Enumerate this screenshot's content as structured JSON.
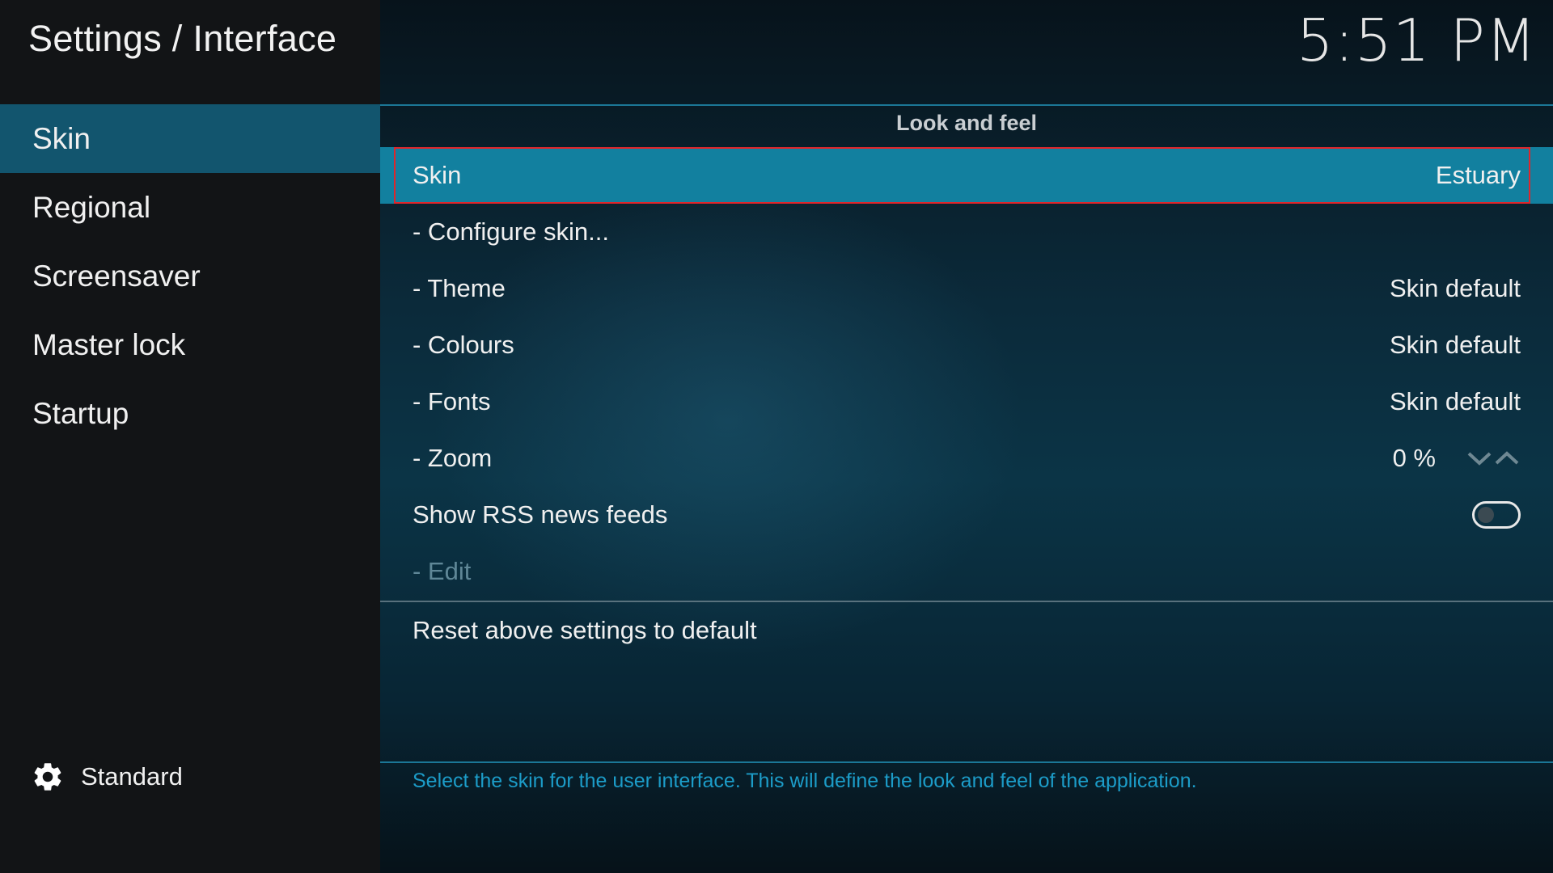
{
  "header": {
    "title": "Settings / Interface",
    "clock": "5:51 PM"
  },
  "sidebar": {
    "items": [
      {
        "label": "Skin",
        "active": true
      },
      {
        "label": "Regional",
        "active": false
      },
      {
        "label": "Screensaver",
        "active": false
      },
      {
        "label": "Master lock",
        "active": false
      },
      {
        "label": "Startup",
        "active": false
      }
    ],
    "settings_level": {
      "icon": "gear-icon",
      "label": "Standard"
    }
  },
  "main": {
    "group_title": "Look and feel",
    "settings": [
      {
        "label": "Skin",
        "value": "Estuary"
      },
      {
        "label": "- Configure skin...",
        "value": ""
      },
      {
        "label": "- Theme",
        "value": "Skin default"
      },
      {
        "label": "- Colours",
        "value": "Skin default"
      },
      {
        "label": "- Fonts",
        "value": "Skin default"
      },
      {
        "label": "- Zoom",
        "value": "0 %",
        "controls": [
          "chevron-down-icon",
          "chevron-up-icon"
        ]
      },
      {
        "label": "Show RSS news feeds",
        "toggle": false
      },
      {
        "label": "- Edit",
        "disabled": true
      }
    ],
    "reset_label": "Reset above settings to default",
    "description": "Select the skin for the user interface. This will define the look and feel of the application."
  },
  "colors": {
    "sidebar_active": "#12556e",
    "row_selected": "#12809f",
    "focus_outline": "#e0262b",
    "description_text": "#1c9cc8"
  }
}
